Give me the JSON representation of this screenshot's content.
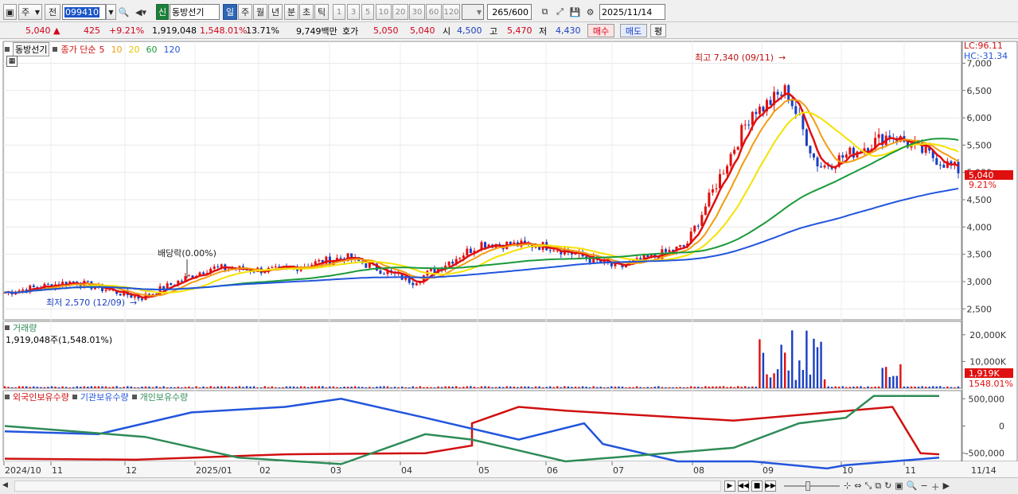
{
  "toolbar": {
    "market_type": "주",
    "prev_label": "전",
    "stock_code": "099410",
    "credit_badge": "신",
    "stock_name": "동방선기",
    "periods": [
      "일",
      "주",
      "월",
      "년",
      "분",
      "초",
      "틱"
    ],
    "active_period": "일",
    "intervals": [
      "1",
      "3",
      "5",
      "10",
      "20",
      "30",
      "60",
      "120"
    ],
    "count_value": "265",
    "count_total": "/600",
    "date_value": "2025/11/14"
  },
  "quote": {
    "price": "5,040",
    "change_arrow": "▲",
    "change": "425",
    "change_pct": "+9.21%",
    "volume": "1,919,048",
    "volume_ratio": "1,548.01%",
    "turnover": "13.71%",
    "trade_value": "9,749백만",
    "bid_label": "호가",
    "ask_price": "5,050",
    "bid_price": "5,040",
    "open_label": "시",
    "open": "4,500",
    "high_label": "고",
    "high": "5,470",
    "low_label": "저",
    "low": "4,430",
    "buy_label": "매수",
    "sell_label": "매도",
    "eval_label": "평"
  },
  "price_panel": {
    "title": "동방선기",
    "ma_label": "종가 단순",
    "ma_periods": [
      "5",
      "10",
      "20",
      "60",
      "120"
    ],
    "ma_colors": [
      "#e01010",
      "#f39c12",
      "#f5e200",
      "#1a9a3a",
      "#2255dd"
    ],
    "lc_label": "LC:96.11",
    "hc_label": "HC:-31.34",
    "max_note": "최고 7,340 (09/11)",
    "min_note": "최저 2,570 (12/09)",
    "dividend_note": "배당락(0.00%)",
    "current_price_tag": "5,040",
    "current_pct_tag": "9.21%",
    "y_ticks": [
      "7,000",
      "6,500",
      "6,000",
      "5,500",
      "5,000",
      "4,500",
      "4,000",
      "3,500",
      "3,000",
      "2,500"
    ]
  },
  "volume_panel": {
    "title": "거래량",
    "value_label": "1,919,048주(1,548.01%)",
    "y_ticks": [
      "20,000K",
      "10,000K"
    ],
    "current_tag": "1,919K",
    "current_pct_tag": "1548.01%"
  },
  "holding_panel": {
    "series_labels": [
      "외국인보유수량",
      "기관보유수량",
      "개인보유수량"
    ],
    "series_colors": [
      "#d01010",
      "#2255dd",
      "#2e8b57"
    ],
    "y_ticks": [
      "500,000",
      "0",
      "-500,000"
    ]
  },
  "x_axis": {
    "labels": [
      "2024/10",
      "11",
      "12",
      "2025/01",
      "02",
      "03",
      "04",
      "05",
      "06",
      "07",
      "08",
      "09",
      "10",
      "11"
    ],
    "end_label": "11/14"
  },
  "chart_data": {
    "type": "line",
    "x": [
      "2024/10",
      "11",
      "12",
      "2025/01",
      "02",
      "03",
      "04",
      "05",
      "06",
      "07",
      "08",
      "09",
      "10",
      "11",
      "11/14"
    ],
    "series": [
      {
        "name": "종가 단순 5",
        "values": [
          2800,
          3000,
          2700,
          3250,
          3200,
          3450,
          3000,
          3700,
          3650,
          3250,
          3650,
          6200,
          5100,
          5700,
          5040
        ]
      },
      {
        "name": "종가 단순 120",
        "values": [
          2700,
          2740,
          2780,
          2850,
          2950,
          3050,
          3150,
          3300,
          3400,
          3450,
          3480,
          3700,
          4000,
          4200,
          4250
        ]
      }
    ],
    "volume_max_label": "20,000K",
    "ylim": [
      2300,
      7400
    ]
  }
}
